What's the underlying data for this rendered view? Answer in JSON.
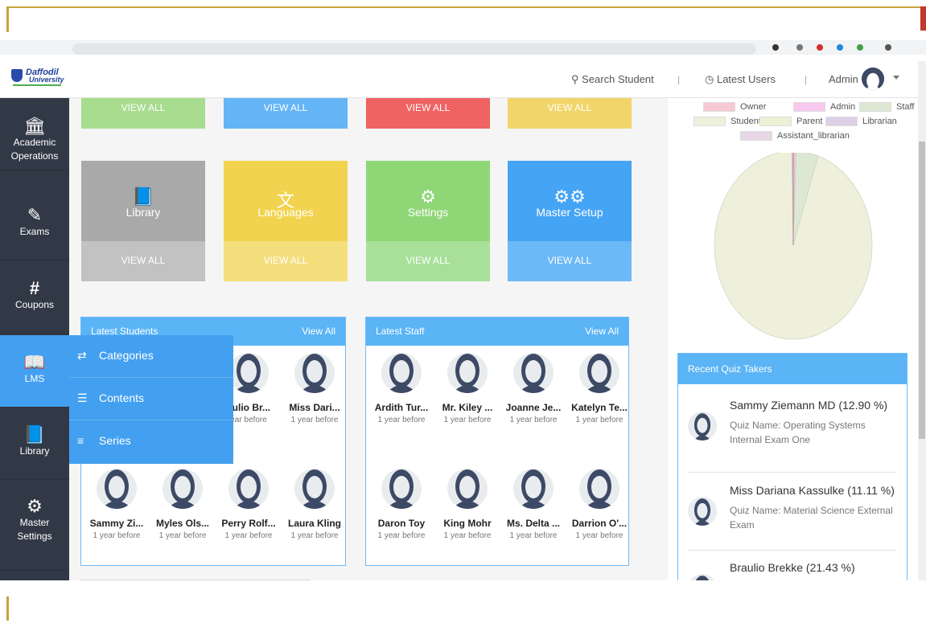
{
  "header": {
    "logo_text_1": "Daffodil",
    "logo_text_2": "University",
    "search_label": "Search Student",
    "latest_users_label": "Latest Users",
    "admin_label": "Admin"
  },
  "sidebar": {
    "items": [
      {
        "label": "Academic Operations",
        "icon": "bank-icon"
      },
      {
        "label": "Exams",
        "icon": "edit-icon"
      },
      {
        "label": "Coupons",
        "icon": "hash-icon"
      },
      {
        "label": "LMS",
        "icon": "book-open-icon"
      },
      {
        "label": "Library",
        "icon": "book-icon"
      },
      {
        "label": "Master Settings",
        "icon": "gear-icon"
      }
    ]
  },
  "lms_menu": {
    "items": [
      {
        "label": "Categories",
        "icon": "shuffle-icon"
      },
      {
        "label": "Contents",
        "icon": "layers-icon"
      },
      {
        "label": "Series",
        "icon": "list-icon"
      }
    ]
  },
  "tiles_top": {
    "view_all": [
      "VIEW ALL",
      "VIEW ALL",
      "VIEW ALL",
      "VIEW ALL"
    ],
    "colors": [
      "#a8dc8f",
      "#64b5f6",
      "#f06363",
      "#f2d56a"
    ]
  },
  "tiles": [
    {
      "label": "Library",
      "view_all": "VIEW ALL",
      "icon": "book-icon",
      "color": "#a9a9a9",
      "color2": "#c2c2c2"
    },
    {
      "label": "Languages",
      "view_all": "VIEW ALL",
      "icon": "translate-icon",
      "color": "#f2d34f",
      "color2": "#f5df7c"
    },
    {
      "label": "Settings",
      "view_all": "VIEW ALL",
      "icon": "gear-icon",
      "color": "#8fd677",
      "color2": "#a8e09a"
    },
    {
      "label": "Master Setup",
      "view_all": "VIEW ALL",
      "icon": "gears-icon",
      "color": "#45a4f4",
      "color2": "#6cb9f7"
    }
  ],
  "students_panel": {
    "title": "Latest Students",
    "view_all": "View All",
    "people": [
      {
        "name": "",
        "time": ""
      },
      {
        "name": "",
        "time": ""
      },
      {
        "name": "aulio Br...",
        "time": "ear before"
      },
      {
        "name": "Miss Dari...",
        "time": "1 year before"
      },
      {
        "name": "Sammy Zi...",
        "time": "1 year before"
      },
      {
        "name": "Myles Ols...",
        "time": "1 year before"
      },
      {
        "name": "Perry Rolf...",
        "time": "1 year before"
      },
      {
        "name": "Laura Kling",
        "time": "1 year before"
      }
    ]
  },
  "staff_panel": {
    "title": "Latest Staff",
    "view_all": "View All",
    "people": [
      {
        "name": "Ardith Tur...",
        "time": "1 year before"
      },
      {
        "name": "Mr. Kiley ...",
        "time": "1 year before"
      },
      {
        "name": "Joanne Je...",
        "time": "1 year before"
      },
      {
        "name": "Katelyn Te...",
        "time": "1 year before"
      },
      {
        "name": "Daron Toy",
        "time": "1 year before"
      },
      {
        "name": "King Mohr",
        "time": "1 year before"
      },
      {
        "name": "Ms. Delta ...",
        "time": "1 year before"
      },
      {
        "name": "Darrion O'...",
        "time": "1 year before"
      }
    ]
  },
  "chart_data": {
    "type": "pie",
    "legend": [
      "Owner",
      "Admin",
      "Staff",
      "Student",
      "Parent",
      "Librarian",
      "Assistant_librarian"
    ],
    "colors": [
      "#f8c8d4",
      "#f8c8f0",
      "#dde8d4",
      "#eef0dc",
      "#eef0d4",
      "#ddd0e4",
      "#e6d6e6"
    ],
    "values": [
      0.3,
      0.3,
      4.5,
      94.6,
      0.1,
      0.1,
      0.1
    ],
    "legend_position": "top"
  },
  "quiz": {
    "title": "Recent Quiz Takers",
    "items": [
      {
        "name": "Sammy Ziemann MD (12.90 %)",
        "detail": "Quiz Name: Operating Systems Internal Exam One"
      },
      {
        "name": "Miss Dariana Kassulke (11.11 %)",
        "detail": "Quiz Name: Material Science External Exam"
      },
      {
        "name": "Braulio Brekke (21.43 %)",
        "detail": ""
      }
    ]
  }
}
